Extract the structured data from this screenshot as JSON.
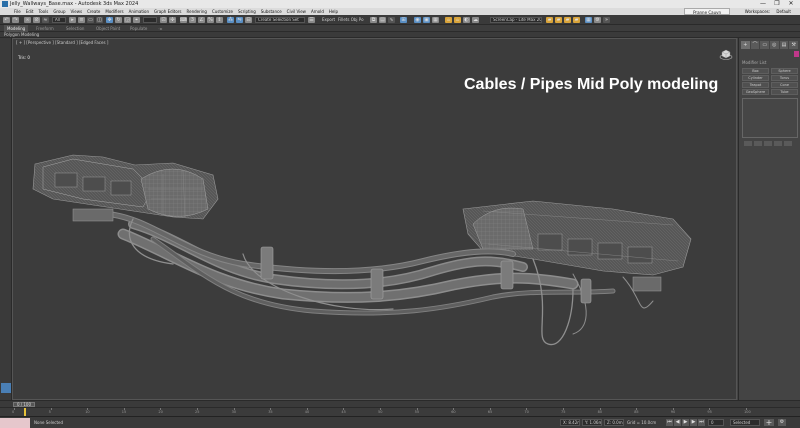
{
  "window": {
    "title": "Jelly_Wallways_Base.max - Autodesk 3ds Max 2024",
    "controls": [
      "—",
      "❐",
      "✕"
    ]
  },
  "menu": {
    "items": [
      "File",
      "Edit",
      "Tools",
      "Group",
      "Views",
      "Create",
      "Modifiers",
      "Animation",
      "Graph Editors",
      "Rendering",
      "Customize",
      "Scripting",
      "Substance",
      "Civil View",
      "Arnold",
      "Help"
    ],
    "sign_in": "Pranne Cauvn",
    "workspace_label": "Workspaces:",
    "workspace_value": "Default"
  },
  "toolbar": {
    "filter_dropdown": "All",
    "create_selection_set": "Create Selection Set",
    "export_label": "Export",
    "render_dropdown": "Fillets Obj Po",
    "scene_dropdown": "ScreenCap - Lite Max 2024"
  },
  "ribbon": {
    "tabs": [
      "Modeling",
      "Freeform",
      "Selection",
      "Object Paint",
      "Populate"
    ],
    "active_tab": "Modeling",
    "sub_label": "Polygon Modeling"
  },
  "viewport": {
    "label": "[ + ] [Perspective ] [Standard ] [Edged Faces ]",
    "stats_label": "Tris:",
    "stats_value": "0",
    "overlay_title": "Cables / Pipes Mid Poly modeling"
  },
  "command_panel": {
    "tab_icons": [
      "+",
      "⌒",
      "▭",
      "◎",
      "▤",
      "⚒"
    ],
    "header": "Modifier List",
    "buttons": [
      "Box",
      "Sphere",
      "Cylinder",
      "Torus",
      "Teapot",
      "Cone",
      "GeoSphere",
      "Tube",
      "Pyramid",
      "Plane"
    ]
  },
  "timeline": {
    "slider_label": "0 / 100",
    "ticks": [
      "0",
      "5",
      "10",
      "15",
      "20",
      "25",
      "30",
      "35",
      "40",
      "45",
      "50",
      "55",
      "60",
      "65",
      "70",
      "75",
      "80",
      "85",
      "90",
      "95",
      "100"
    ]
  },
  "status": {
    "selection": "None Selected",
    "x_field": "X: 8.42m",
    "y_field": "Y: 1.06m",
    "z_field": "Z: 0.0m",
    "grid": "Grid = 10.0cm",
    "add_time_tag": "Add Time Tag",
    "autokey": "Auto Key",
    "selected_dropdown": "Selected",
    "set_key": "Set Key",
    "key_filters": "Key Filters...",
    "frame": "0"
  },
  "colors": {
    "viewport_bg": "#3c3c3c",
    "accent_blue": "#4a7fb5",
    "key_yellow": "#e8c23a",
    "pink": "#c0388a"
  }
}
